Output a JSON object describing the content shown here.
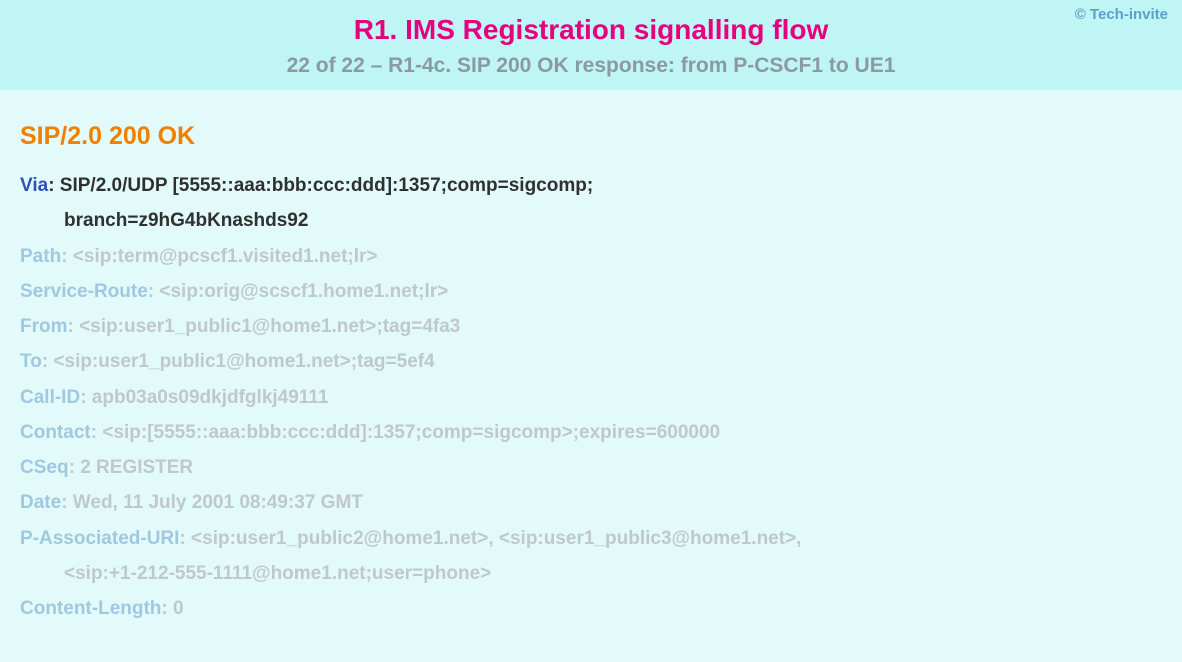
{
  "copyright": "© Tech-invite",
  "title": "R1. IMS Registration signalling flow",
  "subtitle": "22 of 22 – R1-4c. SIP 200 OK response: from P-CSCF1 to UE1",
  "sip_status": "SIP/2.0 200 OK",
  "headers": [
    {
      "name": "Via",
      "sep": ": ",
      "value": "SIP/2.0/UDP [5555::aaa:bbb:ccc:ddd]:1357;comp=sigcomp;",
      "active": true,
      "indent": false
    },
    {
      "name": "",
      "sep": "",
      "value": "branch=z9hG4bKnashds92",
      "active": true,
      "indent": true
    },
    {
      "name": "Path",
      "sep": ": ",
      "value": "<sip:term@pcscf1.visited1.net;lr>",
      "active": false,
      "indent": false
    },
    {
      "name": "Service-Route",
      "sep": ": ",
      "value": "<sip:orig@scscf1.home1.net;lr>",
      "active": false,
      "indent": false
    },
    {
      "name": "From",
      "sep": ": ",
      "value": "<sip:user1_public1@home1.net>;tag=4fa3",
      "active": false,
      "indent": false
    },
    {
      "name": "To",
      "sep": ": ",
      "value": "<sip:user1_public1@home1.net>;tag=5ef4",
      "active": false,
      "indent": false
    },
    {
      "name": "Call-ID",
      "sep": ": ",
      "value": "apb03a0s09dkjdfglkj49111",
      "active": false,
      "indent": false
    },
    {
      "name": "Contact",
      "sep": ": ",
      "value": "<sip:[5555::aaa:bbb:ccc:ddd]:1357;comp=sigcomp>;expires=600000",
      "active": false,
      "indent": false
    },
    {
      "name": "CSeq",
      "sep": ": ",
      "value": "2 REGISTER",
      "active": false,
      "indent": false
    },
    {
      "name": "Date",
      "sep": ": ",
      "value": "Wed, 11 July 2001 08:49:37 GMT",
      "active": false,
      "indent": false
    },
    {
      "name": "P-Associated-URI",
      "sep": ": ",
      "value": "<sip:user1_public2@home1.net>, <sip:user1_public3@home1.net>,",
      "active": false,
      "indent": false
    },
    {
      "name": "",
      "sep": "",
      "value": "<sip:+1-212-555-1111@home1.net;user=phone>",
      "active": false,
      "indent": true
    },
    {
      "name": "Content-Length",
      "sep": ": ",
      "value": "0",
      "active": false,
      "indent": false
    }
  ]
}
